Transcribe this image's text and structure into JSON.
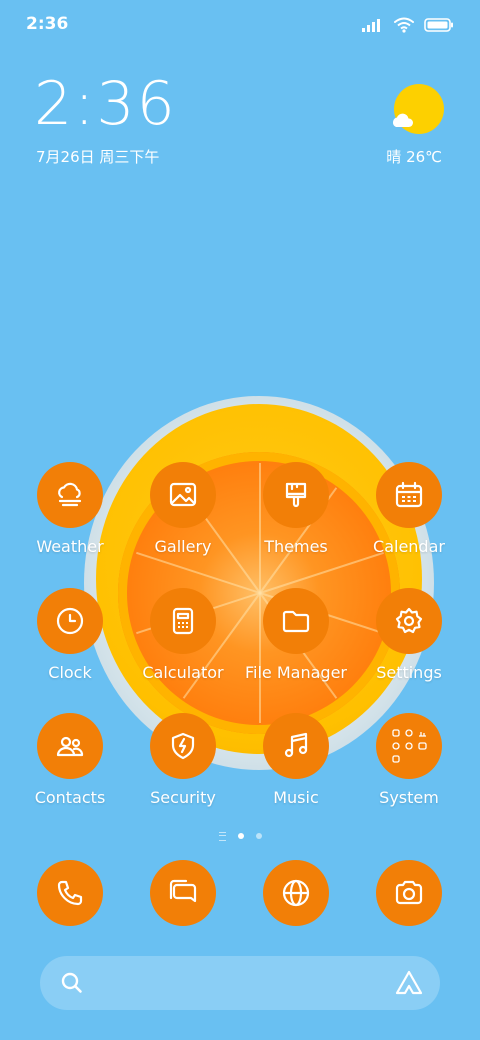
{
  "status_bar": {
    "time": "2:36",
    "icons": [
      "signal-icon",
      "wifi-icon",
      "battery-icon"
    ]
  },
  "clock_widget": {
    "time": "2:36",
    "date": "7月26日 周三下午"
  },
  "weather_widget": {
    "icon": "sun-cloud-icon",
    "text": "晴 26℃"
  },
  "apps": [
    {
      "label": "Weather",
      "icon": "weather-icon"
    },
    {
      "label": "Gallery",
      "icon": "gallery-icon"
    },
    {
      "label": "Themes",
      "icon": "themes-brush-icon"
    },
    {
      "label": "Calendar",
      "icon": "calendar-icon"
    },
    {
      "label": "Clock",
      "icon": "clock-icon"
    },
    {
      "label": "Calculator",
      "icon": "calculator-icon"
    },
    {
      "label": "File Manager",
      "icon": "folder-icon"
    },
    {
      "label": "Settings",
      "icon": "gear-icon"
    },
    {
      "label": "Contacts",
      "icon": "contacts-icon"
    },
    {
      "label": "Security",
      "icon": "shield-bolt-icon"
    },
    {
      "label": "Music",
      "icon": "music-note-icon"
    },
    {
      "label": "System",
      "icon": "folder-grid-icon"
    }
  ],
  "page_indicator": {
    "pages": 2,
    "active": 1
  },
  "dock": [
    {
      "icon": "phone-icon"
    },
    {
      "icon": "messages-icon"
    },
    {
      "icon": "browser-globe-icon"
    },
    {
      "icon": "camera-icon"
    }
  ],
  "search_bar": {
    "icon": "search-icon",
    "assistant_icon": "assistant-icon"
  },
  "colors": {
    "background": "#69c0f2",
    "icon_accent": "#f27f07",
    "sun": "#fdd000"
  }
}
